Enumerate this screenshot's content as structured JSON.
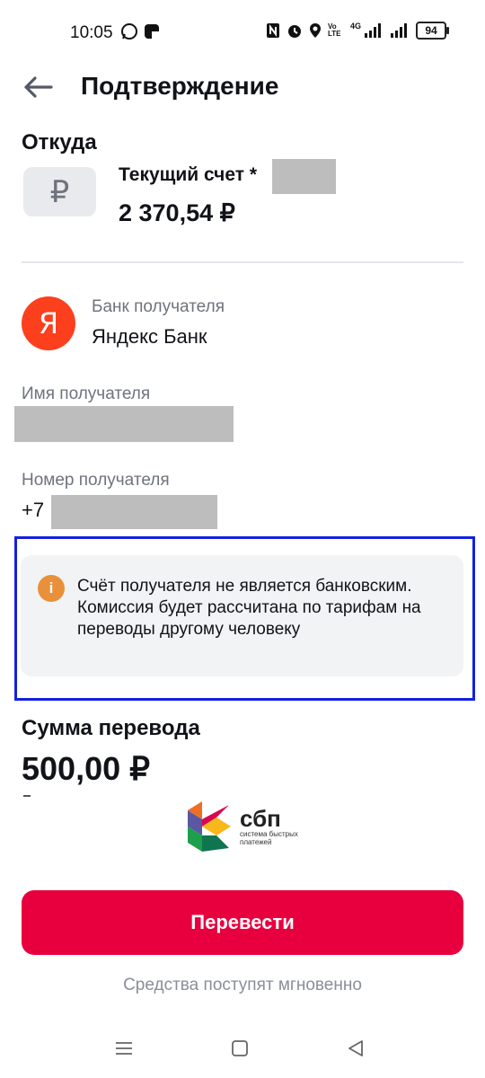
{
  "status_bar": {
    "time": "10:05",
    "network_label": "4G",
    "volte_label": "Vo LTE",
    "battery": "94"
  },
  "header": {
    "title": "Подтверждение"
  },
  "from": {
    "section_title": "Откуда",
    "currency_symbol": "₽",
    "account_name": "Текущий счет *",
    "balance": "2 370,54 ₽"
  },
  "recipient": {
    "bank_label": "Банк получателя",
    "bank_name": "Яндекс Банк",
    "bank_logo_letter": "Я",
    "name_label": "Имя получателя",
    "phone_label": "Номер получателя",
    "phone_prefix": "+7"
  },
  "notice": {
    "icon": "i",
    "text": "Счёт получателя не является банковским. Комиссия будет рассчитана по тарифам на переводы другому человеку"
  },
  "amount": {
    "title": "Сумма перевода",
    "value": "500,00 ₽"
  },
  "sbp": {
    "word": "сбп",
    "subtitle_line1": "система быстрых",
    "subtitle_line2": "платежей"
  },
  "actions": {
    "transfer_label": "Перевести",
    "footnote": "Средства поступят мгновенно"
  },
  "colors": {
    "accent": "#e8003e",
    "yandex": "#fc3f1d",
    "info": "#e8913a",
    "highlight_frame": "#1320e0"
  }
}
